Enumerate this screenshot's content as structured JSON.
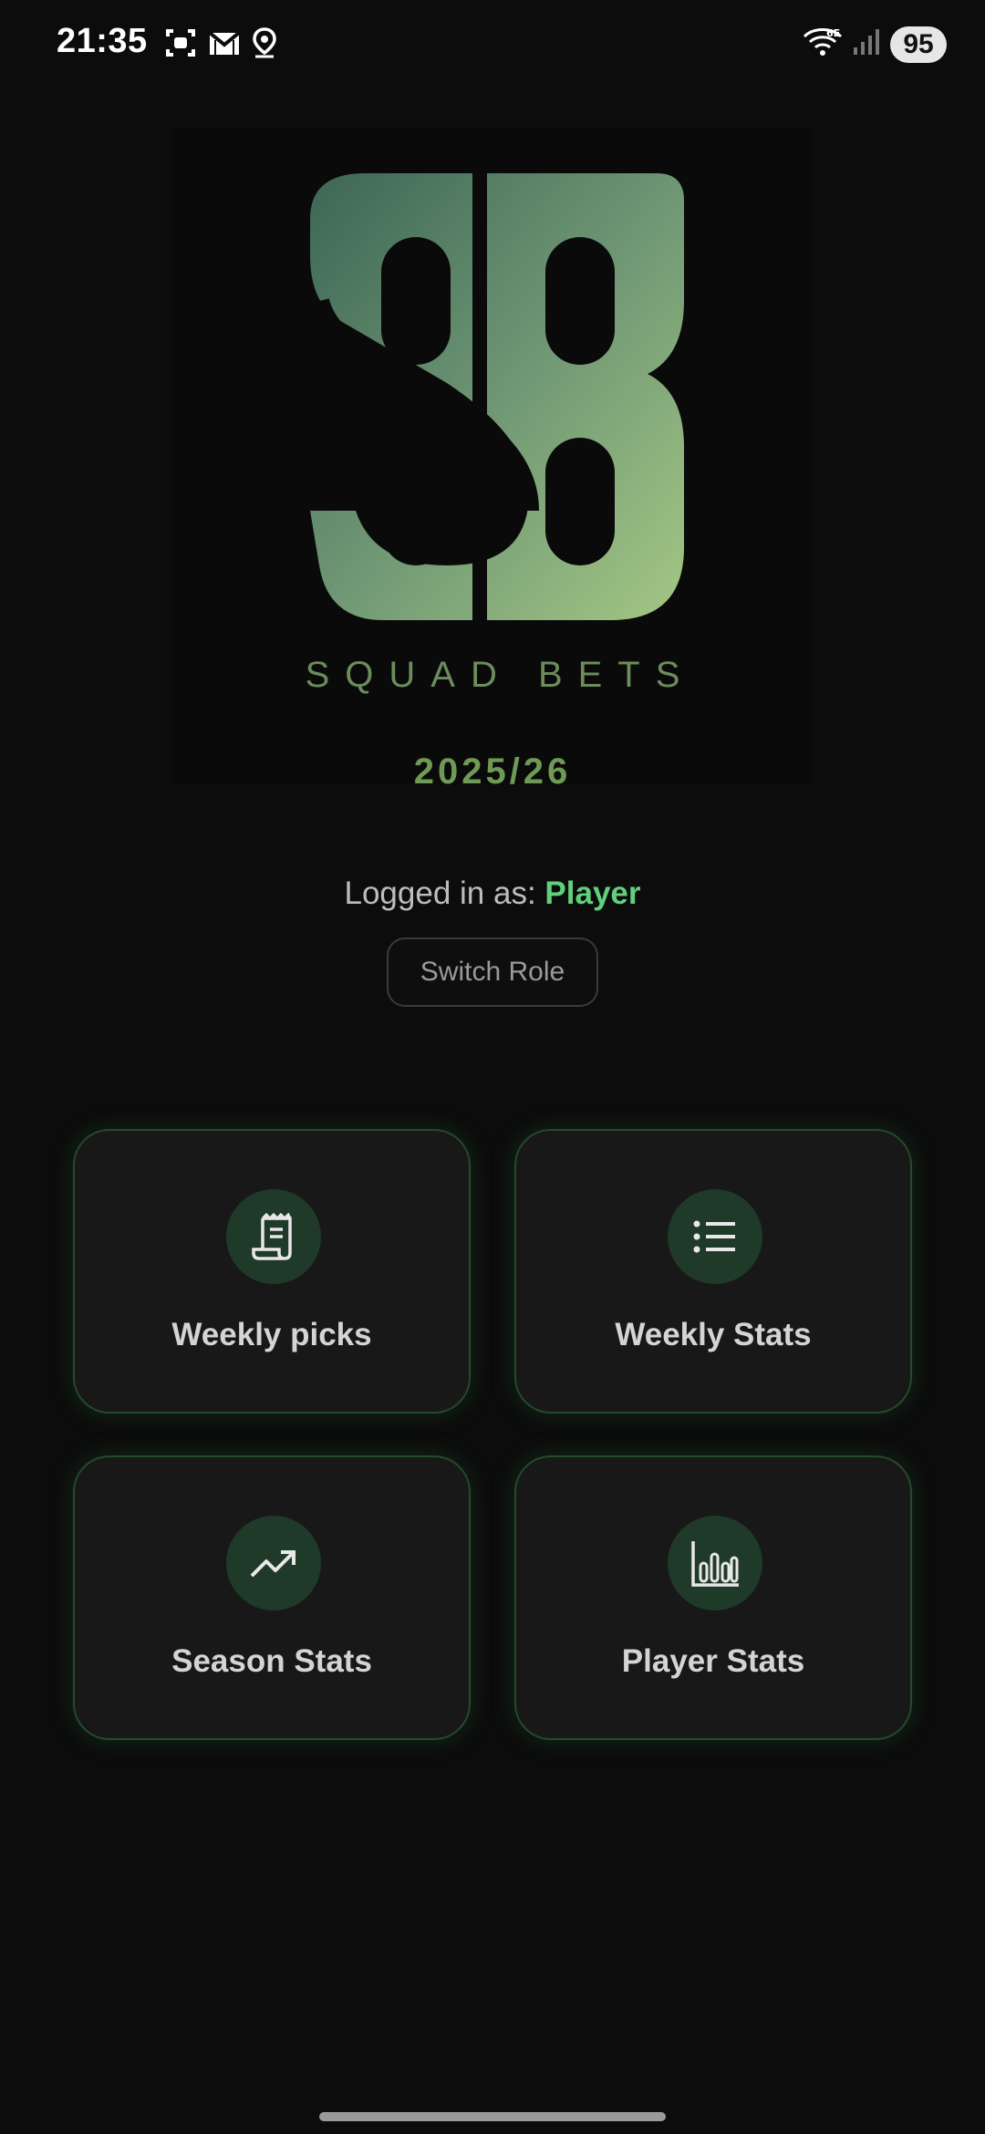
{
  "status_bar": {
    "time": "21:35",
    "battery": "95",
    "icons_left": [
      "screenshot-icon",
      "gmail-icon",
      "location-icon"
    ],
    "icons_right": [
      "wifi-6e-icon",
      "signal-icon"
    ]
  },
  "brand": {
    "logo_letters": "SB",
    "tagline": "SQUAD BETS",
    "season": "2025/26"
  },
  "session": {
    "logged_in_prefix": "Logged in as:",
    "role": "Player",
    "switch_role_label": "Switch Role"
  },
  "menu": {
    "items": [
      {
        "label": "Weekly picks",
        "icon": "receipt-icon"
      },
      {
        "label": "Weekly Stats",
        "icon": "list-icon"
      },
      {
        "label": "Season Stats",
        "icon": "trending-up-icon"
      },
      {
        "label": "Player Stats",
        "icon": "bar-chart-icon"
      }
    ]
  },
  "colors": {
    "background": "#0c0c0c",
    "accent": "#5fd07b",
    "card_background": "#181818",
    "card_border": "#244a2d",
    "icon_circle": "#1f3a28"
  }
}
